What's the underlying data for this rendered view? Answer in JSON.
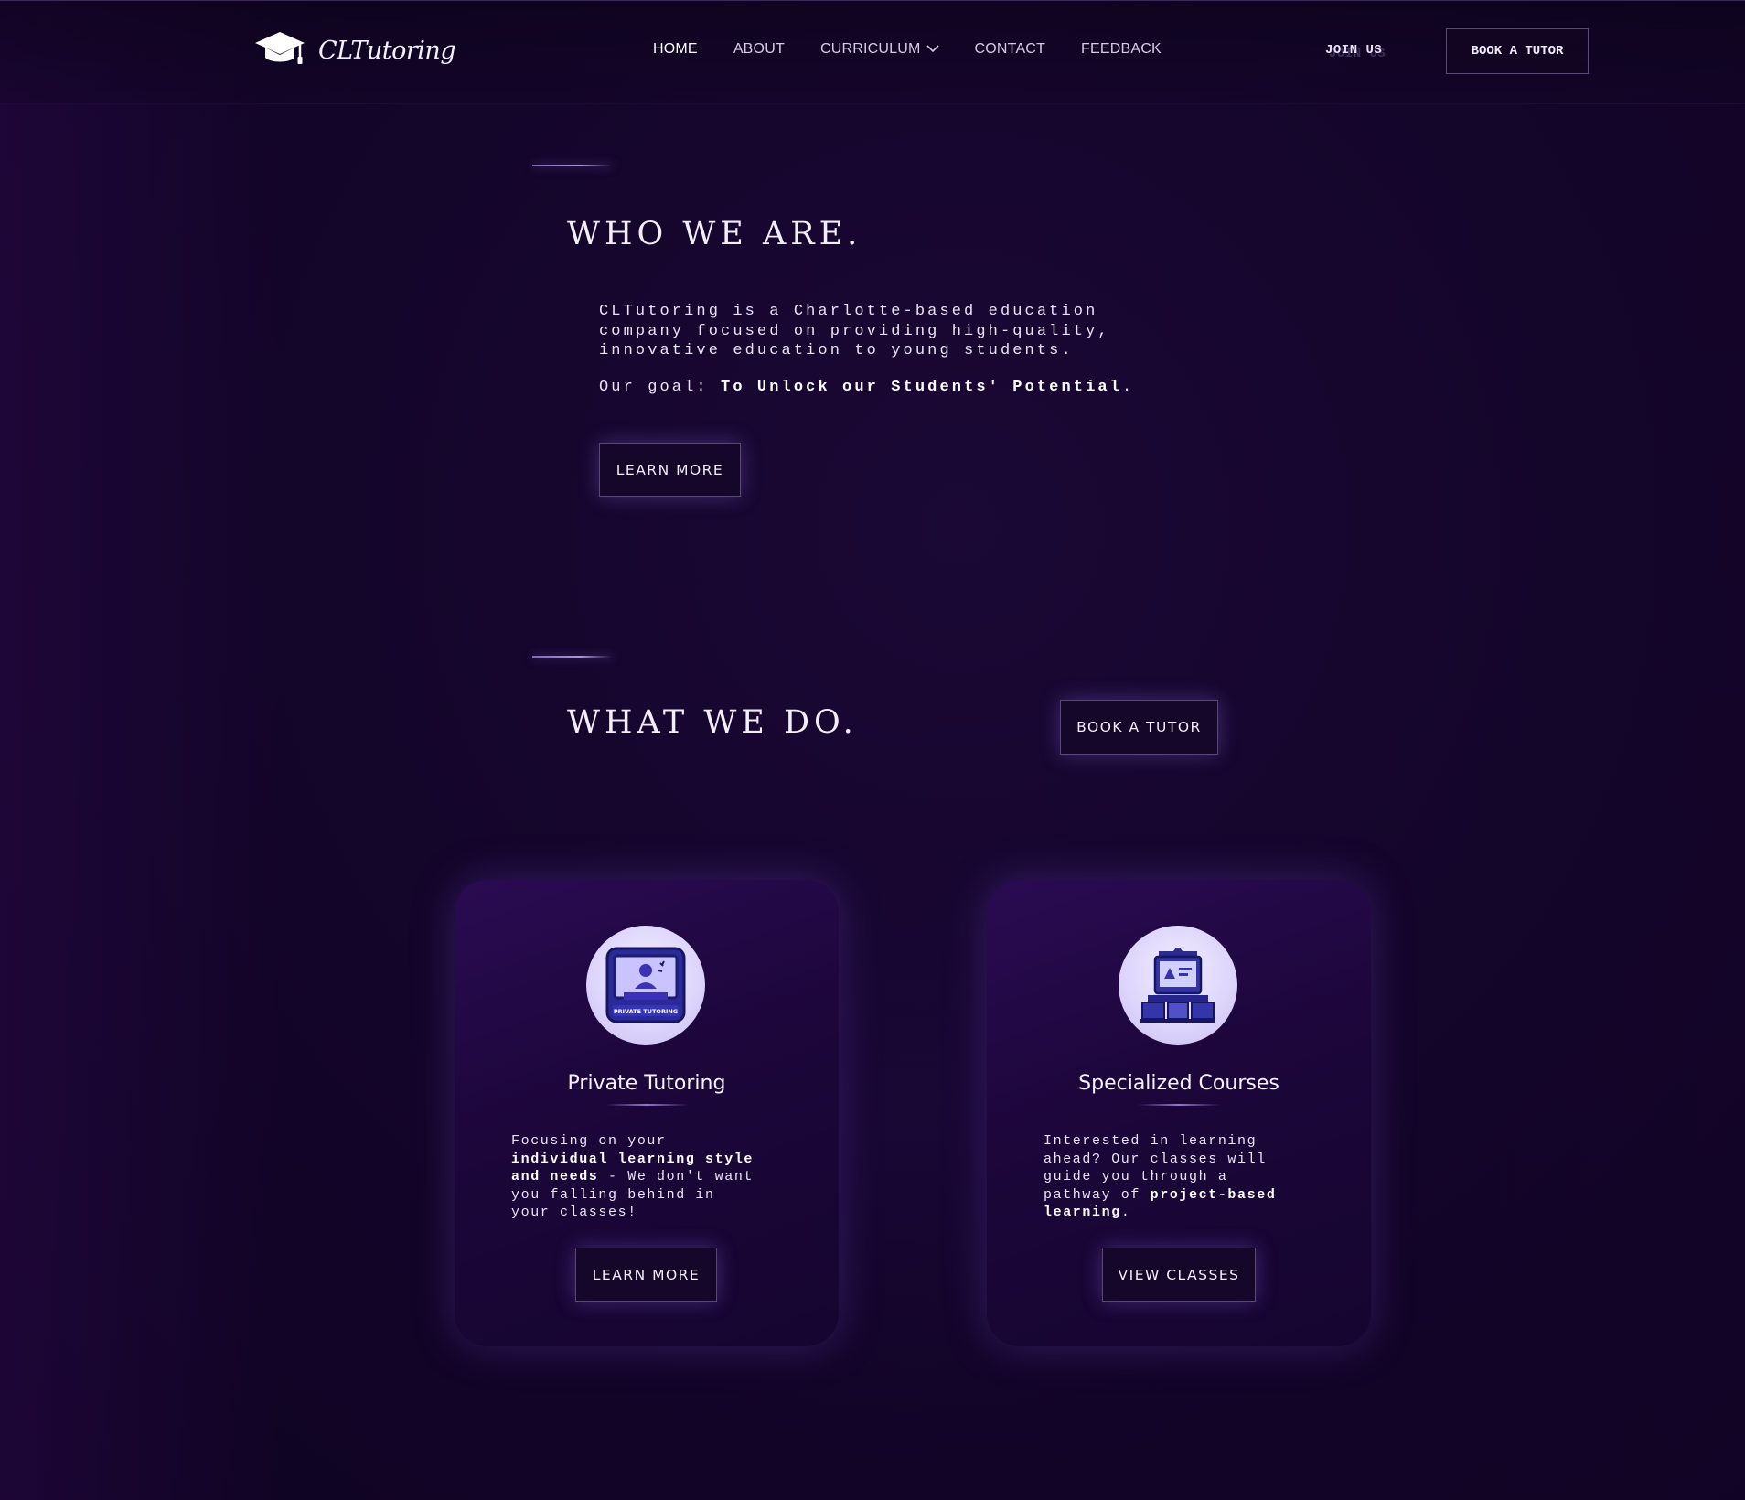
{
  "nav": {
    "logo_text": "CLTutoring",
    "links": [
      {
        "label": "HOME"
      },
      {
        "label": "ABOUT"
      },
      {
        "label": "CURRICULUM"
      },
      {
        "label": "CONTACT"
      },
      {
        "label": "FEEDBACK"
      }
    ],
    "join_label": "JOIN US",
    "book_label": "BOOK A TUTOR"
  },
  "who": {
    "heading": "WHO WE ARE.",
    "p1_line1": "CLTutoring is a Charlotte-based education",
    "p1_line2": "company focused on providing high-quality,",
    "p1_line3": "innovative education to young students.",
    "goal_prefix": "Our goal:",
    "goal_bold": "To Unlock our Students' Potential",
    "goal_suffix": ".",
    "button": "LEARN MORE"
  },
  "what": {
    "heading": "WHAT WE DO.",
    "button": "BOOK A TUTOR"
  },
  "cards": [
    {
      "title": "Private Tutoring",
      "icon_caption": "PRIVATE TUTORING",
      "p_line1": "Focusing on your",
      "p_line2_bold": "individual learning style",
      "p_line3_bold": "and needs",
      "p_line3_rest": " - We don't want",
      "p_line4": "you falling behind in",
      "p_line5": "your classes!",
      "button": "LEARN MORE"
    },
    {
      "title": "Specialized Courses",
      "p_line1": "Interested in learning",
      "p_line2": "ahead? Our classes will",
      "p_line3": "guide you through a",
      "p_line4_pre": "pathway of ",
      "p_line4_bold": "project-based",
      "p_line5_bold": "learning",
      "p_line5_rest": ".",
      "button": "VIEW CLASSES"
    }
  ],
  "colors": {
    "background": "#14052b",
    "card": "#1f0840",
    "accent": "#8f7ad0",
    "icon_circle": "#e4ddfc"
  },
  "icons": [
    "graduation-cap-icon",
    "chevron-down-icon",
    "tutor-screen-icon",
    "course-building-icon"
  ]
}
